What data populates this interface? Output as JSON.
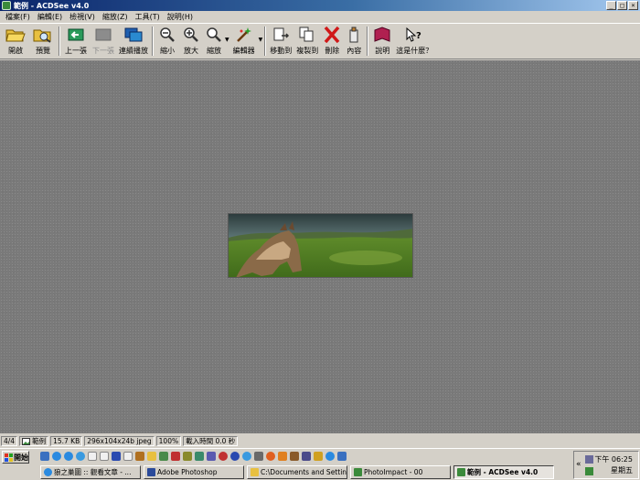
{
  "window": {
    "title": "範例 - ACDSee v4.0",
    "controls": [
      "_",
      "□",
      "×"
    ]
  },
  "menu": [
    "檔案(F)",
    "編輯(E)",
    "檢視(V)",
    "縮放(Z)",
    "工具(T)",
    "說明(H)"
  ],
  "toolbar": {
    "open": "開啟",
    "preview": "預覽",
    "previous": "上一張",
    "next": "下一張",
    "slideshow": "連續播放",
    "zoom_out": "縮小",
    "zoom_in": "放大",
    "zoom": "縮放",
    "editor": "編輯器",
    "move_to": "移動到",
    "copy_to": "複製到",
    "delete": "刪除",
    "properties": "內容",
    "help": "說明",
    "whats_this": "這是什麼？"
  },
  "toolbar_state": {
    "next_enabled": false
  },
  "image": {
    "description_hidden": true
  },
  "status": {
    "index": "4/4",
    "name": "範例",
    "size": "15.7 KB",
    "dims": "296x104x24b jpeg",
    "zoom": "100%",
    "load_time": "載入時間 0.0 秒"
  },
  "taskbar": {
    "start": "開始",
    "tasks": [
      "狼之巢圖 :: 觀看文章 - ...",
      "Adobe Photoshop",
      "C:\\Documents and Setting...",
      "PhotoImpact - 00",
      "範例 - ACDSee v4.0"
    ],
    "active_index": 4,
    "clock_time": "下午 06:25",
    "clock_day": "星期五",
    "tray_arrow": "«"
  },
  "colors": {
    "titlebar_start": "#0a246a",
    "titlebar_end": "#a6caf0",
    "viewer_bg": "#7a7a7a",
    "window_face": "#d4d0c8"
  }
}
